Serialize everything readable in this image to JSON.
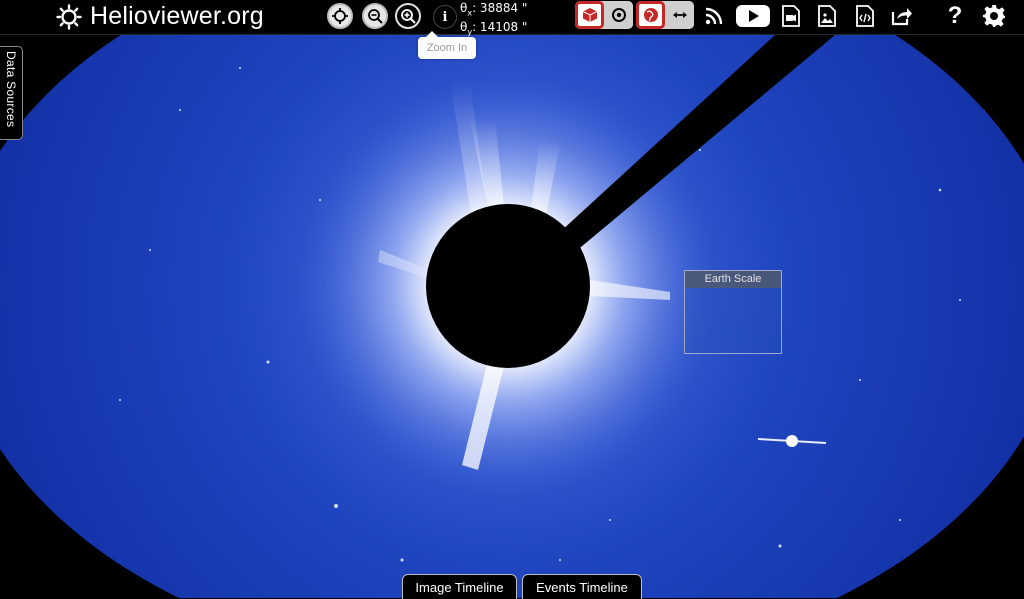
{
  "header": {
    "title": "Helioviewer.org"
  },
  "controls": {
    "center_icon": "crosshair-icon",
    "zoom_out_icon": "zoom-out-icon",
    "zoom_in_icon": "zoom-in-icon",
    "info_label": "i",
    "tooltip": "Zoom In"
  },
  "coords": {
    "x_label": "θ",
    "x_sub": "x",
    "x_value": ": 38884 \"",
    "y_label": "θ",
    "y_sub": "y",
    "y_value": ": 14108 \""
  },
  "toggles": {
    "view_3d_icon": "cube-icon",
    "view_2d_icon": "target-icon",
    "earth_icon": "globe-icon",
    "scale_icon": "arrow-horizontal-icon"
  },
  "right_icons": [
    "rss-icon",
    "youtube-icon",
    "movie-icon",
    "screenshot-icon",
    "embed-icon",
    "share-icon",
    "help-icon",
    "settings-icon"
  ],
  "right_icon_labels": {
    "help": "?"
  },
  "sidebar": {
    "data_sources_label": "Data Sources"
  },
  "earth_scale": {
    "label": "Earth Scale"
  },
  "timeline": {
    "image_label": "Image Timeline",
    "events_label": "Events Timeline"
  },
  "colors": {
    "corona_blue": "#1a3fb8",
    "deep_blue": "#0a1f8c",
    "toggle_accent": "#c62828",
    "background": "#000000"
  }
}
